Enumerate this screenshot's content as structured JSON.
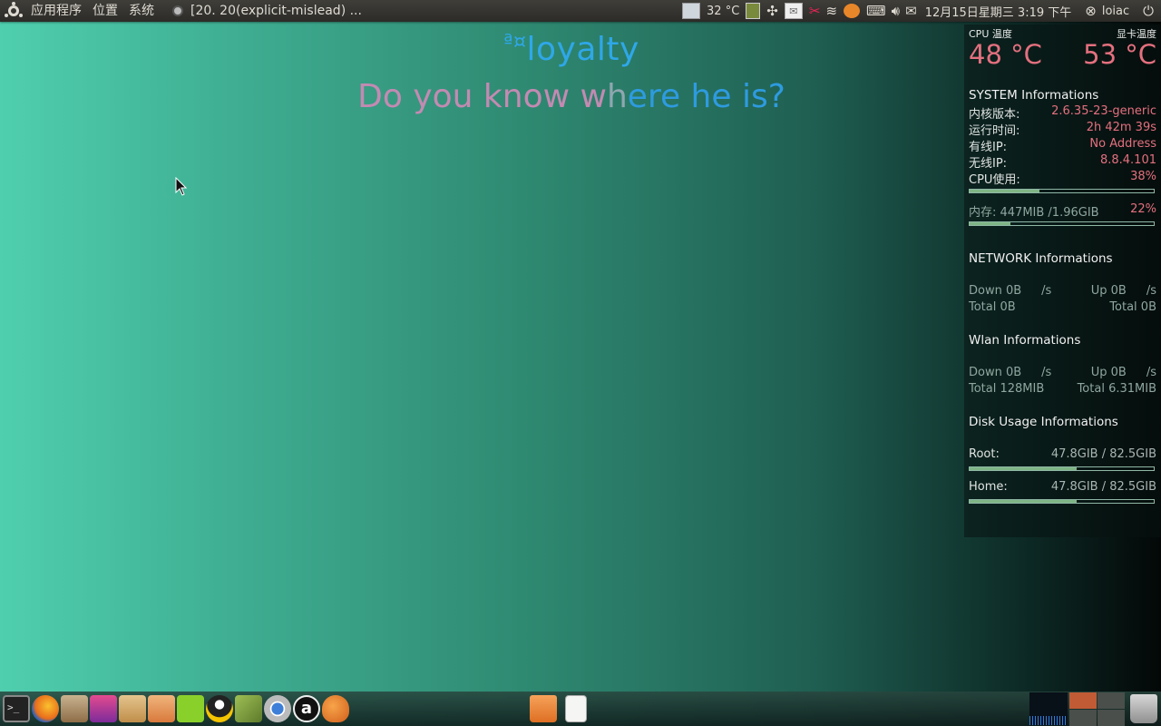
{
  "top_panel": {
    "menus": [
      "应用程序",
      "位置",
      "系统"
    ],
    "window_title": "[20. 20(explicit-mislead) ...",
    "temperature": "32 °C",
    "clock": "12月15日星期三  3:19 下午",
    "user": "loiac",
    "icons": [
      "display-temp-icon",
      "battery-icon",
      "power-manager-icon",
      "mail-icon",
      "bluetooth-icon",
      "wifi-icon",
      "weather-icon",
      "keyboard-icon",
      "volume-icon",
      "message-icon",
      "user-status-icon",
      "shutdown-icon"
    ]
  },
  "desktop": {
    "brand_prefix": "ª¤",
    "brand": "loyalty",
    "tagline_part1": "Do you know w",
    "tagline_part2": "h",
    "tagline_part3": "ere he is?"
  },
  "conky": {
    "cpu_temp_label": "CPU 温度",
    "gpu_temp_label": "显卡温度",
    "cpu_temp": "48 °C",
    "gpu_temp": "53 °C",
    "system_title": "SYSTEM Informations",
    "kernel_label": "内核版本:",
    "kernel": "2.6.35-23-generic",
    "uptime_label": "运行时间:",
    "uptime": "2h 42m 39s",
    "wired_ip_label": "有线IP:",
    "wired_ip": "No Address",
    "wireless_ip_label": "无线IP:",
    "wireless_ip": "8.8.4.101",
    "cpu_usage_label": "CPU使用:",
    "cpu_usage": "38%",
    "cpu_usage_fraction": 0.38,
    "memory_label": "内存: 447MIB  /1.96GIB",
    "memory_percent": "22%",
    "memory_fraction": 0.22,
    "network_title": "NETWORK Informations",
    "net_down": "Down 0B",
    "net_down_unit": "/s",
    "net_up": "Up 0B",
    "net_up_unit": "/s",
    "net_total_down": "Total 0B",
    "net_total_up": "Total 0B",
    "wlan_title": "Wlan Informations",
    "wlan_down": "Down 0B",
    "wlan_down_unit": "/s",
    "wlan_up": "Up 0B",
    "wlan_up_unit": "/s",
    "wlan_total_down": "Total 128MIB",
    "wlan_total_up": "Total 6.31MIB",
    "disk_title": "Disk Usage Informations",
    "root_label": "Root:",
    "root_value": "47.8GIB / 82.5GIB",
    "root_fraction": 0.58,
    "home_label": "Home:",
    "home_value": "47.8GIB / 82.5GIB",
    "home_fraction": 0.58
  },
  "dock": {
    "launchers": [
      "terminal",
      "firefox",
      "system-tools",
      "media-editor",
      "downloads",
      "uploads",
      "recycle",
      "qq",
      "ebook",
      "chromium",
      "amazon",
      "paint"
    ],
    "amazon_letter": "a"
  },
  "colors": {
    "accent_pink": "#e4707f",
    "brand_blue": "#2fa7e8",
    "bar_fill": "#7fb585"
  }
}
